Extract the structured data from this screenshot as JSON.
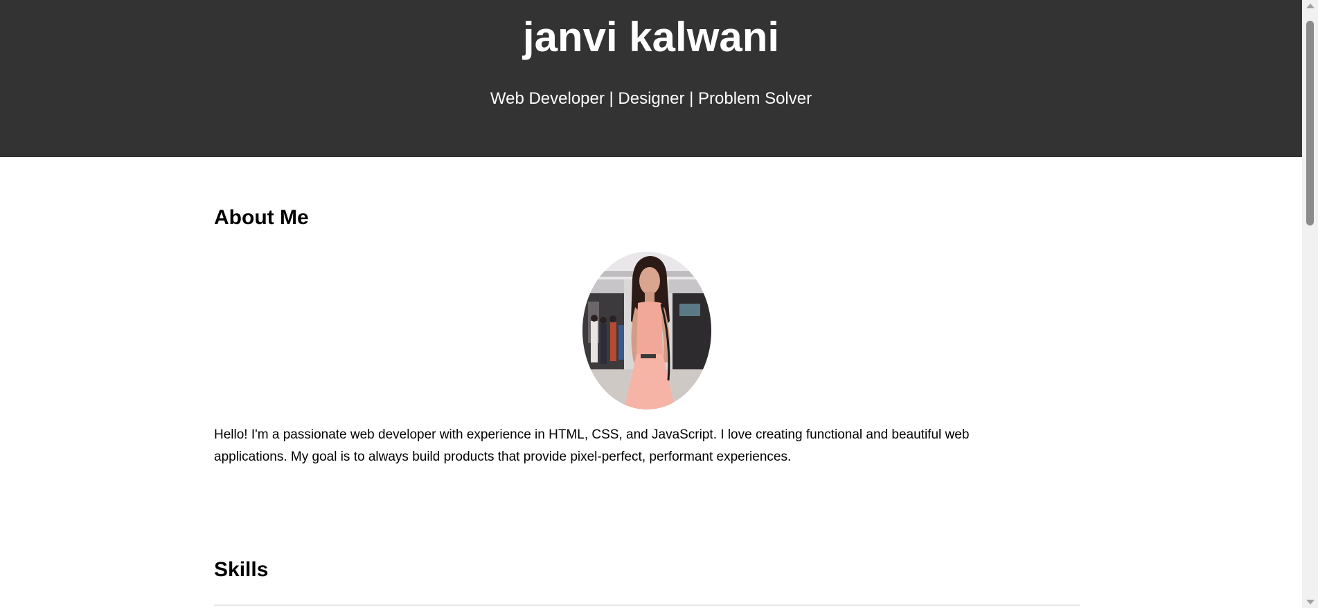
{
  "header": {
    "name": "janvi kalwani",
    "tagline": "Web Developer | Designer | Problem Solver",
    "background_color": "#333333"
  },
  "about": {
    "title": "About Me",
    "photo": "profile-photo",
    "text": "Hello! I'm a passionate web developer with experience in HTML, CSS, and JavaScript. I love creating functional and beautiful web applications. My goal is to always build products that provide pixel-perfect, performant experiences."
  },
  "skills": {
    "title": "Skills"
  },
  "scrollbar": {
    "up_icon": "arrow-up-icon",
    "down_icon": "arrow-down-icon"
  }
}
